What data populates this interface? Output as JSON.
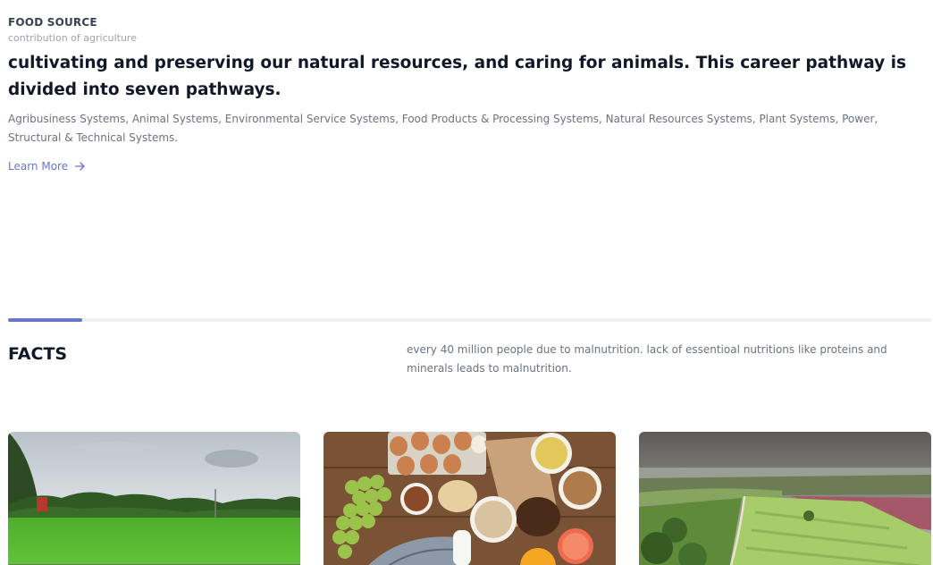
{
  "hero": {
    "eyebrow": "FOOD SOURCE",
    "subtitle": "contribution of agriculture",
    "headline": "cultivating and preserving our natural resources, and caring for animals. This career pathway is divided into seven pathways.",
    "description": "Agribusiness Systems, Animal Systems, Environmental Service Systems, Food Products & Processing Systems, Natural Resources Systems, Plant Systems, Power, Structural & Technical Systems.",
    "learn_more": "Learn More",
    "learn_more_icon": "arrow-right-icon"
  },
  "progress": {
    "value_percent": 8,
    "color": "#6978c7"
  },
  "facts": {
    "title": "FACTS",
    "text": "every 40 million people due to malnutrition. lack of essentioal nutritions like proteins and minerals leads to malnutrition."
  },
  "cards": [
    {
      "image": "rice-field-photo"
    },
    {
      "image": "food-ingredients-photo"
    },
    {
      "image": "aerial-farmland-photo"
    }
  ],
  "colors": {
    "accent": "#6978c7",
    "heading": "#111827",
    "body_text": "#6b7280"
  }
}
